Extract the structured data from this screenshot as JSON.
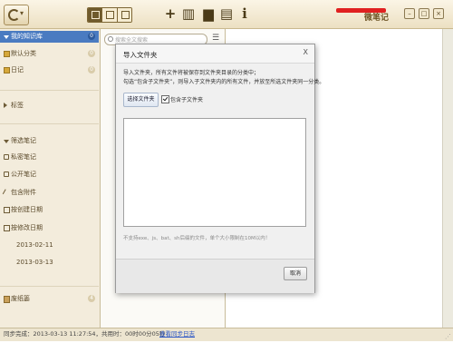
{
  "app": {
    "brand": "微笔记"
  },
  "toolbar": {
    "icons": [
      "add-icon",
      "notebook-icon",
      "trash-icon",
      "print-icon",
      "info-icon"
    ],
    "add_glyph": "+",
    "notebook_glyph": "▥",
    "trash_glyph": "▆",
    "print_glyph": "▤",
    "info_glyph": "i",
    "win_min": "–",
    "win_max": "□",
    "win_close": "×"
  },
  "sidebar": {
    "library": {
      "label": "我的知识库",
      "count": "0"
    },
    "groups": [
      {
        "label": "默认分类",
        "count": "0"
      },
      {
        "label": "日记",
        "count": "0"
      }
    ],
    "tags_label": "标签",
    "filter": {
      "label": "筛选笔记",
      "items": [
        {
          "label": "私密笔记"
        },
        {
          "label": "公开笔记"
        },
        {
          "label": "包含附件"
        },
        {
          "label": "按创建日期"
        },
        {
          "label": "按修改日期"
        },
        {
          "label": "2013-02-11"
        },
        {
          "label": "2013-03-13"
        }
      ]
    },
    "trash": {
      "label": "废纸篓",
      "count": "4"
    }
  },
  "notelist": {
    "search_placeholder": "搜索全文搜索",
    "toggle_glyph": "☰"
  },
  "dialog": {
    "title": "导入文件夹",
    "close": "X",
    "desc_line1": "导入文件夹，所有文件将被保存到文件夹目录的分类中；",
    "desc_line2": "勾选“包含子文件夹”，则导入子文件夹内的所有文件，并放至所选文件夹同一分类。",
    "choose_button": "选择文件夹",
    "include_subfolders": "包含子文件夹",
    "include_subfolders_checked": true,
    "note": "不支持exe、js、bat、sh后缀的文件，单个大小限制在10M以内！",
    "cancel_button": "取消"
  },
  "status": {
    "text": "同步完成：2013-03-13 11:27:54，共用时：00时00分05秒",
    "link": "查看同步日志"
  }
}
